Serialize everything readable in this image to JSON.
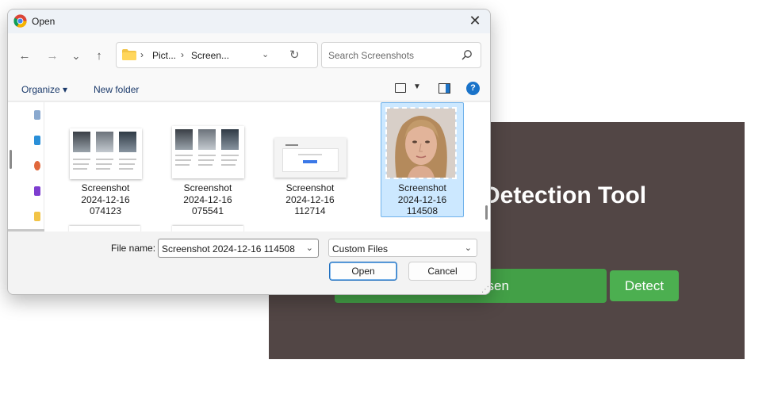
{
  "app": {
    "title": "Detection Tool",
    "choose_button_label": "osen",
    "detect_button_label": "Detect"
  },
  "dialog": {
    "title": "Open",
    "nav": {
      "back_label": "←",
      "forward_label": "→",
      "recent_label": "⌄",
      "up_label": "↑"
    },
    "address": {
      "crumbs": [
        "Pict...",
        "Screen..."
      ],
      "separator": "›",
      "dropdown_label": "⌄",
      "refresh_label": "↻"
    },
    "search": {
      "placeholder": "Search Screenshots"
    },
    "commands": {
      "organize_label": "Organize ▾",
      "new_folder_label": "New folder",
      "help_label": "?"
    },
    "files": [
      {
        "line1": "Screenshot",
        "line2": "2024-12-16",
        "line3": "074123",
        "selected": false
      },
      {
        "line1": "Screenshot",
        "line2": "2024-12-16",
        "line3": "075541",
        "selected": false
      },
      {
        "line1": "Screenshot",
        "line2": "2024-12-16",
        "line3": "112714",
        "selected": false
      },
      {
        "line1": "Screenshot",
        "line2": "2024-12-16",
        "line3": "114508",
        "selected": true
      }
    ],
    "file_name": {
      "label": "File name:",
      "value": "Screenshot 2024-12-16 114508"
    },
    "file_type": {
      "value": "Custom Files"
    },
    "open_label": "Open",
    "cancel_label": "Cancel",
    "caret_glyph": "⌄",
    "close_glyph": "✕"
  },
  "colors": {
    "app_panel": "#524645",
    "choose_button": "#43a047",
    "detect_button": "#4caf50",
    "selection": "#cce8ff",
    "accent": "#1a73c9"
  }
}
